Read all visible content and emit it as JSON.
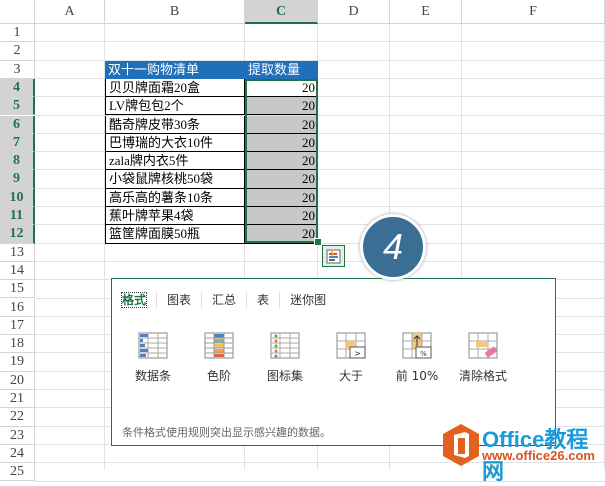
{
  "columns": [
    "A",
    "B",
    "C",
    "D",
    "E",
    "F"
  ],
  "selected_column": "C",
  "row_count": 25,
  "selected_rows": [
    4,
    5,
    6,
    7,
    8,
    9,
    10,
    11,
    12
  ],
  "table": {
    "header": [
      "双十一购物清单",
      "提取数量"
    ],
    "items": [
      "贝贝牌面霜20盒",
      "LV牌包包2个",
      "酷奇牌皮带30条",
      "巴博瑞的大衣10件",
      "zala牌内衣5件",
      "小袋鼠牌核桃50袋",
      "高乐高的薯条10条",
      "蕉叶牌苹果4袋",
      "篮筐牌面膜50瓶"
    ],
    "values": [
      "20",
      "20",
      "20",
      "20",
      "20",
      "20",
      "20",
      "20",
      "20"
    ]
  },
  "quick_analysis": {
    "tabs": [
      "格式",
      "图表",
      "汇总",
      "表",
      "迷你图"
    ],
    "buttons": [
      "数据条",
      "色阶",
      "图标集",
      "大于",
      "前 10%",
      "清除格式"
    ],
    "description": "条件格式使用规则突出显示感兴趣的数据。"
  },
  "step_badge": "4",
  "watermark": {
    "title": "Office教程网",
    "url": "www.office26.com"
  },
  "colors": {
    "excel_green": "#217346",
    "header_blue": "#1f6fba",
    "badge": "#3a6e94"
  }
}
